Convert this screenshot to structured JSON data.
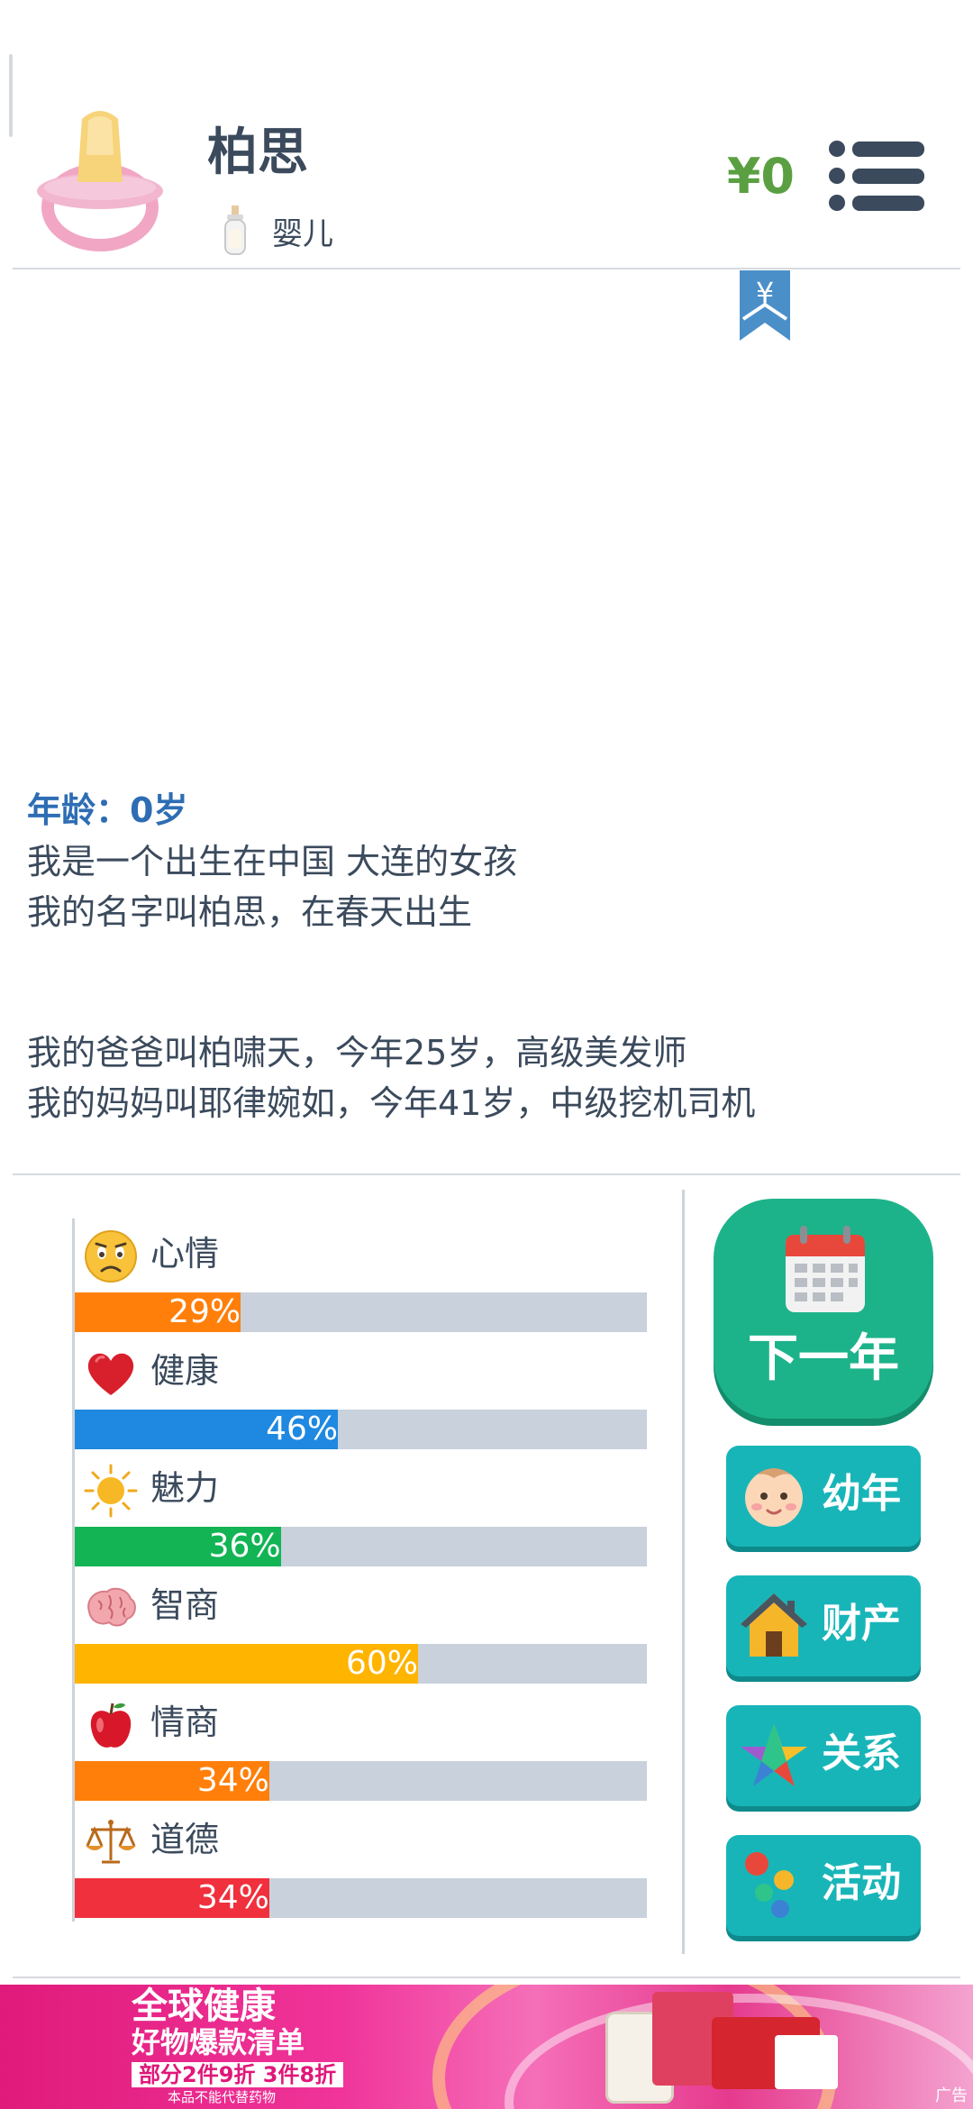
{
  "header": {
    "name": "柏思",
    "stage": "婴儿",
    "money": "¥0",
    "bookmark_symbol": "¥",
    "accent_green": "#5aa042"
  },
  "story": {
    "age": "年龄：0岁",
    "lines_top": [
      "我是一个出生在中国 大连的女孩",
      "我的名字叫柏思，在春天出生"
    ],
    "lines_bottom": [
      "我的爸爸叫柏啸天，今年25岁，高级美发师",
      "我的妈妈叫耶律婉如，今年41岁，中级挖机司机"
    ]
  },
  "stats": [
    {
      "label": "心情",
      "value": 29,
      "text": "29%",
      "color": "#ff7f0a",
      "icon": "sad-face-icon"
    },
    {
      "label": "健康",
      "value": 46,
      "text": "46%",
      "color": "#1f88e0",
      "icon": "heart-icon"
    },
    {
      "label": "魅力",
      "value": 36,
      "text": "36%",
      "color": "#12b454",
      "icon": "sun-icon"
    },
    {
      "label": "智商",
      "value": 60,
      "text": "60%",
      "color": "#ffb400",
      "icon": "brain-icon"
    },
    {
      "label": "情商",
      "value": 34,
      "text": "34%",
      "color": "#ff7f0a",
      "icon": "apple-icon"
    },
    {
      "label": "道德",
      "value": 34,
      "text": "34%",
      "color": "#f0303c",
      "icon": "scales-icon"
    }
  ],
  "actions": {
    "next_year": "下一年",
    "buttons": [
      {
        "label": "幼年",
        "icon": "baby-face-icon"
      },
      {
        "label": "财产",
        "icon": "house-icon"
      },
      {
        "label": "关系",
        "icon": "star-icon"
      },
      {
        "label": "活动",
        "icon": "dots-icon"
      }
    ]
  },
  "ad": {
    "title": "全球健康",
    "subtitle": "好物爆款清单",
    "promo": "部分2件9折 3件8折",
    "disclaimer": "本品不能代替药物",
    "tag": "广告"
  }
}
